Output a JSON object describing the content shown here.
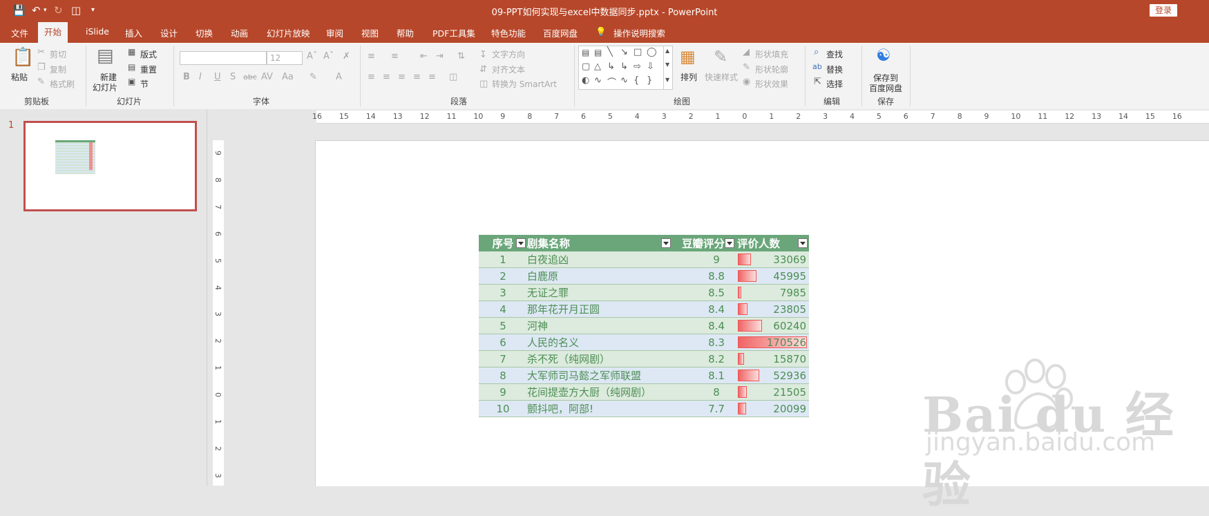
{
  "window": {
    "title": "09-PPT如何实现与excel中数据同步.pptx  -  PowerPoint",
    "login": "登录"
  },
  "tabs": [
    "文件",
    "开始",
    "iSlide",
    "插入",
    "设计",
    "切换",
    "动画",
    "幻灯片放映",
    "审阅",
    "视图",
    "帮助",
    "PDF工具集",
    "特色功能",
    "百度网盘",
    "操作说明搜索"
  ],
  "ribbon": {
    "clipboard": {
      "paste": "粘贴",
      "cut": "剪切",
      "copy": "复制",
      "format_painter": "格式刷",
      "label": "剪贴板"
    },
    "slides": {
      "new_slide_1": "新建",
      "new_slide_2": "幻灯片",
      "layout": "版式",
      "reset": "重置",
      "section": "节",
      "label": "幻灯片"
    },
    "font": {
      "size": "12",
      "label": "字体",
      "bold": "B",
      "italic": "I",
      "underline": "U",
      "shadow": "S",
      "strike": "abc",
      "spacing": "AV",
      "case": "Aa",
      "color": "A"
    },
    "paragraph": {
      "text_direction": "文字方向",
      "align_text": "对齐文本",
      "smartart": "转换为 SmartArt",
      "label": "段落"
    },
    "drawing": {
      "arrange": "排列",
      "quick_styles": "快速样式",
      "shape_fill": "形状填充",
      "shape_outline": "形状轮廓",
      "shape_effects": "形状效果",
      "label": "绘图"
    },
    "editing": {
      "find": "查找",
      "replace": "替换",
      "select": "选择",
      "label": "编辑"
    },
    "save": {
      "save_1": "保存到",
      "save_2": "百度网盘",
      "label": "保存"
    }
  },
  "thumbnail": {
    "number": "1"
  },
  "ruler": {
    "h_ticks": [
      "16",
      "15",
      "14",
      "13",
      "12",
      "11",
      "10",
      "9",
      "8",
      "7",
      "6",
      "5",
      "4",
      "3",
      "2",
      "1",
      "0",
      "1",
      "2",
      "3",
      "4",
      "5",
      "6",
      "7",
      "8",
      "9",
      "10",
      "11",
      "12",
      "13",
      "14",
      "15",
      "16"
    ],
    "v_ticks": [
      "9",
      "8",
      "7",
      "6",
      "5",
      "4",
      "3",
      "2",
      "1",
      "0",
      "1",
      "2",
      "3"
    ]
  },
  "table": {
    "headers": [
      "序号",
      "剧集名称",
      "豆瓣评分",
      "评价人数"
    ],
    "rows": [
      {
        "id": "1",
        "name": "白夜追凶",
        "score": "9",
        "count": "33069",
        "bar": 0.194
      },
      {
        "id": "2",
        "name": "白鹿原",
        "score": "8.8",
        "count": "45995",
        "bar": 0.27
      },
      {
        "id": "3",
        "name": "无证之罪",
        "score": "8.5",
        "count": "7985",
        "bar": 0.047
      },
      {
        "id": "4",
        "name": "那年花开月正圆",
        "score": "8.4",
        "count": "23805",
        "bar": 0.14
      },
      {
        "id": "5",
        "name": "河神",
        "score": "8.4",
        "count": "60240",
        "bar": 0.353
      },
      {
        "id": "6",
        "name": "人民的名义",
        "score": "8.3",
        "count": "170526",
        "bar": 1.0
      },
      {
        "id": "7",
        "name": "杀不死（纯网剧）",
        "score": "8.2",
        "count": "15870",
        "bar": 0.093
      },
      {
        "id": "8",
        "name": "大军师司马懿之军师联盟",
        "score": "8.1",
        "count": "52936",
        "bar": 0.31
      },
      {
        "id": "9",
        "name": "花间提壶方大厨（纯网剧）",
        "score": "8",
        "count": "21505",
        "bar": 0.126
      },
      {
        "id": "10",
        "name": "颤抖吧，阿部!",
        "score": "7.7",
        "count": "20099",
        "bar": 0.118
      }
    ]
  },
  "watermark": {
    "brand": "Bai du 经验",
    "url": "jingyan.baidu.com"
  },
  "colors": {
    "accent": "#b7472a",
    "table_header": "#6aa67a",
    "databar": "#f06464"
  }
}
